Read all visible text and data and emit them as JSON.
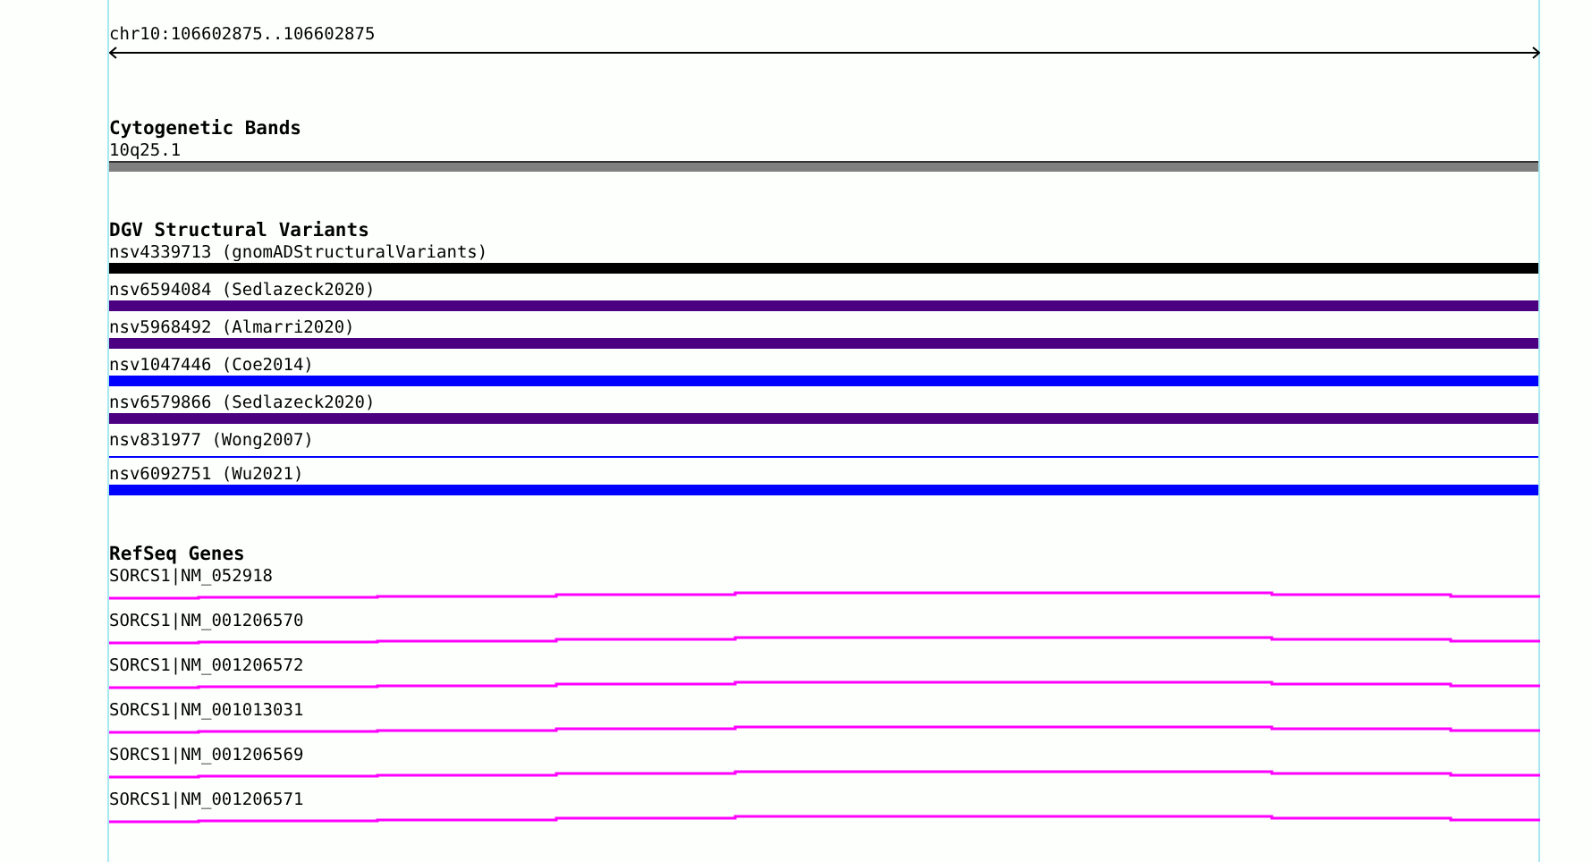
{
  "ruler": {
    "label": "chr10:106602875..106602875"
  },
  "tracks": [
    {
      "title": "Cytogenetic Bands",
      "kind": "band",
      "features": [
        {
          "label": "10q25.1",
          "color": "#808080",
          "kind": "thick"
        }
      ]
    },
    {
      "title": "DGV Structural Variants",
      "kind": "variant",
      "features": [
        {
          "label": "nsv4339713 (gnomADStructuralVariants)",
          "color": "#000000",
          "kind": "thick"
        },
        {
          "label": "nsv6594084 (Sedlazeck2020)",
          "color": "#4b0082",
          "kind": "thick"
        },
        {
          "label": "nsv5968492 (Almarri2020)",
          "color": "#4b0082",
          "kind": "thick"
        },
        {
          "label": "nsv1047446 (Coe2014)",
          "color": "#0000ff",
          "kind": "thick"
        },
        {
          "label": "nsv6579866 (Sedlazeck2020)",
          "color": "#4b0082",
          "kind": "thick"
        },
        {
          "label": "nsv831977 (Wong2007)",
          "color": "#0000ff",
          "kind": "thin"
        },
        {
          "label": "nsv6092751 (Wu2021)",
          "color": "#0000ff",
          "kind": "thick"
        }
      ]
    },
    {
      "title": "RefSeq Genes",
      "kind": "gene",
      "features": [
        {
          "label": "SORCS1|NM_052918",
          "color": "#ff00ff",
          "kind": "gene"
        },
        {
          "label": "SORCS1|NM_001206570",
          "color": "#ff00ff",
          "kind": "gene"
        },
        {
          "label": "SORCS1|NM_001206572",
          "color": "#ff00ff",
          "kind": "gene"
        },
        {
          "label": "SORCS1|NM_001013031",
          "color": "#ff00ff",
          "kind": "gene"
        },
        {
          "label": "SORCS1|NM_001206569",
          "color": "#ff00ff",
          "kind": "gene"
        },
        {
          "label": "SORCS1|NM_001206571",
          "color": "#ff00ff",
          "kind": "gene"
        }
      ]
    }
  ]
}
